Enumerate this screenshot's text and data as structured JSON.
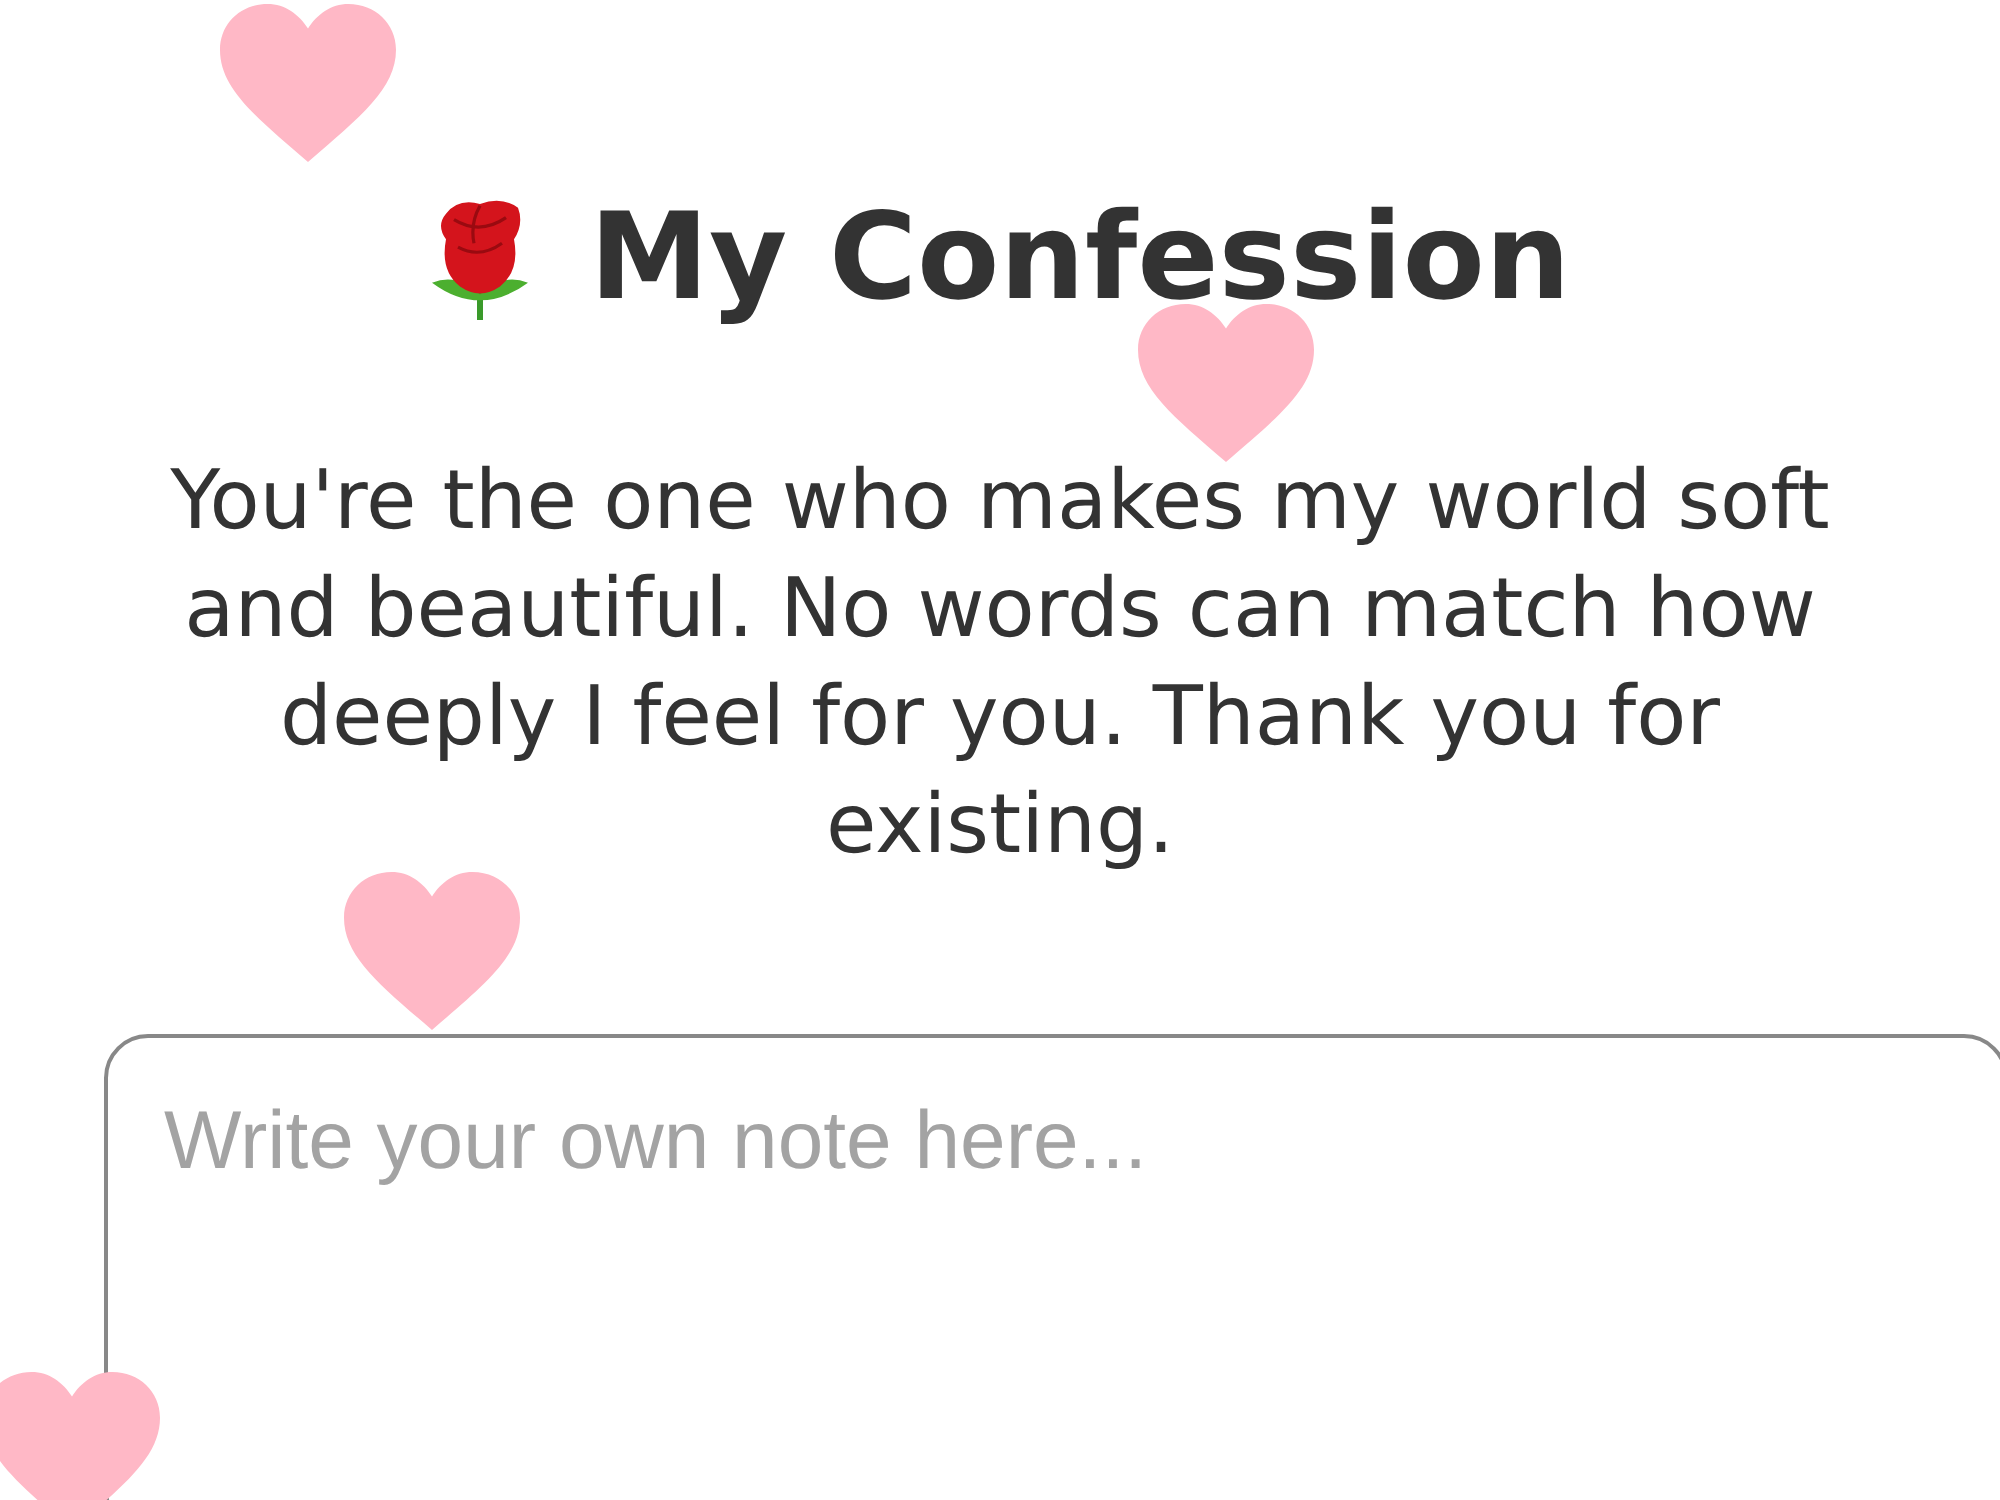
{
  "title": "My Confession",
  "message": "You're the one who makes my world soft and beautiful. No words can match how deeply I feel for you. Thank you for existing.",
  "note": {
    "placeholder": "Write your own note here..."
  }
}
